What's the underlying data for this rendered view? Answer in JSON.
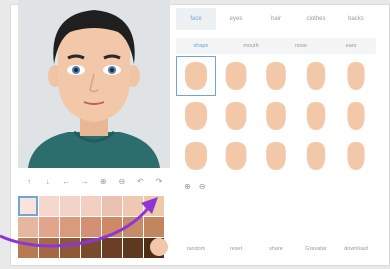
{
  "tabs": [
    {
      "label": "face",
      "active": true
    },
    {
      "label": "eyes",
      "active": false
    },
    {
      "label": "hair",
      "active": false
    },
    {
      "label": "clothes",
      "active": false
    },
    {
      "label": "backs",
      "active": false
    }
  ],
  "subtabs": [
    {
      "label": "shape",
      "active": true
    },
    {
      "label": "mouth",
      "active": false
    },
    {
      "label": "nose",
      "active": false
    },
    {
      "label": "ears",
      "active": false
    }
  ],
  "tools": [
    {
      "icon": "arrow-up-icon",
      "glyph": "↑"
    },
    {
      "icon": "arrow-down-icon",
      "glyph": "↓"
    },
    {
      "icon": "arrow-left-icon",
      "glyph": "←"
    },
    {
      "icon": "arrow-right-icon",
      "glyph": "→"
    },
    {
      "icon": "zoom-in-icon",
      "glyph": "⊕"
    },
    {
      "icon": "zoom-out-icon",
      "glyph": "⊖"
    },
    {
      "icon": "undo-icon",
      "glyph": "↶"
    },
    {
      "icon": "redo-icon",
      "glyph": "↷"
    }
  ],
  "swatches": [
    "#f8e4da",
    "#f5d7cd",
    "#f3d3c9",
    "#f2cfc0",
    "#eac0b0",
    "#efc8b2",
    "#eec9ac",
    "#e6b7a0",
    "#e3a48c",
    "#d99b7c",
    "#d58f74",
    "#cf8967",
    "#c98a67",
    "#c2865e",
    "#b77b52",
    "#a56a45",
    "#8e5735",
    "#7a4a2c",
    "#6b3f24",
    "#5e381f",
    "#4e2d18"
  ],
  "selected_swatch_index": 0,
  "circle_swatch_color": "#f2c6a8",
  "face_shapes_count": 15,
  "selected_shape_index": 0,
  "zoom": [
    {
      "icon": "zoom-in-icon",
      "glyph": "⊕"
    },
    {
      "icon": "zoom-out-icon",
      "glyph": "⊖"
    }
  ],
  "actions": [
    {
      "label": "random"
    },
    {
      "label": "reset"
    },
    {
      "label": "share"
    },
    {
      "label": "Gravatar"
    },
    {
      "label": "download"
    }
  ],
  "colors": {
    "accent": "#6fa5d8",
    "skin": "#f3c8a8",
    "hair": "#1f1f1f",
    "shirt": "#2c6e6d",
    "preview_bg": "#dfe3e6",
    "annotation_arrow": "#8e35d6"
  }
}
